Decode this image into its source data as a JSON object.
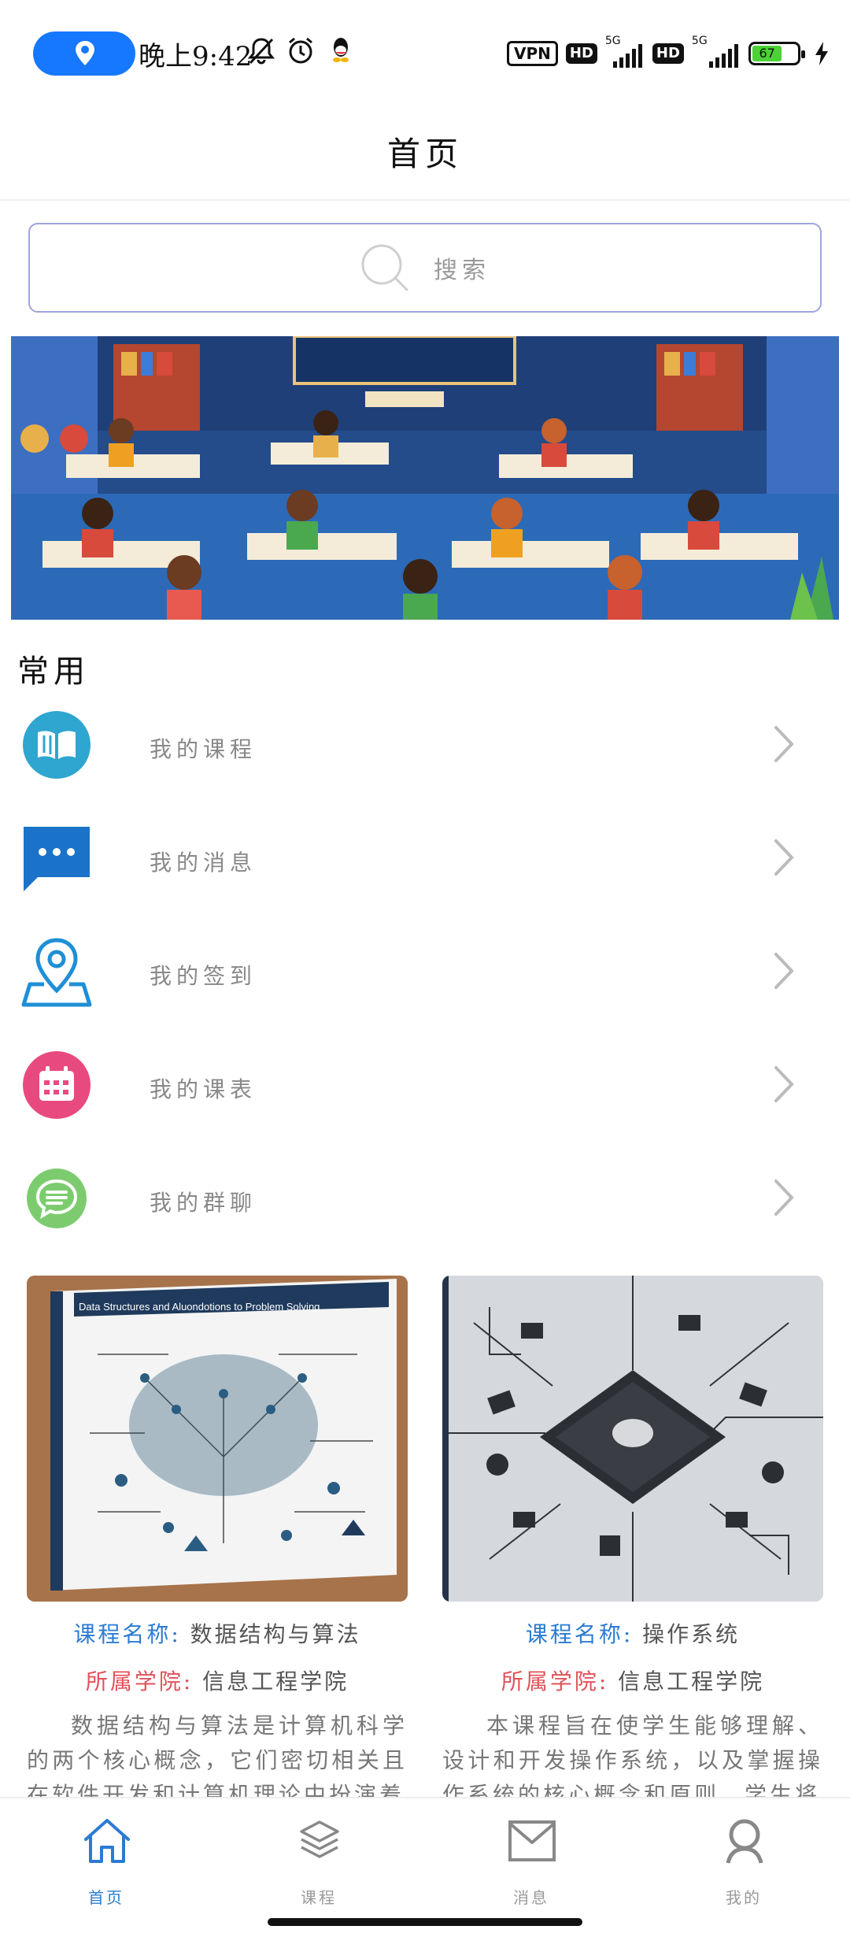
{
  "status_bar": {
    "time": "晚上9:42",
    "vpn": "VPN",
    "hd1": "HD",
    "hd2": "HD",
    "net1": "5G",
    "net2": "5G",
    "battery": "67",
    "icons": [
      "location-icon",
      "mute-icon",
      "alarm-icon",
      "qq-icon",
      "charging-icon"
    ]
  },
  "header": {
    "title": "首页"
  },
  "search": {
    "placeholder": "搜索"
  },
  "banner": {
    "icon": "classroom-illustration"
  },
  "common": {
    "title": "常用",
    "items": [
      {
        "label": "我的课程",
        "icon": "book-icon",
        "color": "#2fa6cf"
      },
      {
        "label": "我的消息",
        "icon": "message-icon",
        "color": "#1b73c9"
      },
      {
        "label": "我的签到",
        "icon": "location-pin-icon",
        "color": "#1f8fd6"
      },
      {
        "label": "我的课表",
        "icon": "calendar-icon",
        "color": "#e84a7f"
      },
      {
        "label": "我的群聊",
        "icon": "chat-icon",
        "color": "#7ccc6f"
      }
    ]
  },
  "courses": [
    {
      "name_label": "课程名称:",
      "name": "数据结构与算法",
      "college_label": "所属学院:",
      "college": "信息工程学院",
      "desc": "数据结构与算法是计算机科学的两个核心概念，它们密切相关且在软件开发和计算机理论中扮演着",
      "cover_title": "Data Structures and Aluondotions to Problem Solving"
    },
    {
      "name_label": "课程名称:",
      "name": "操作系统",
      "college_label": "所属学院:",
      "college": "信息工程学院",
      "desc": "本课程旨在使学生能够理解、设计和开发操作系统，以及掌握操作系统的核心概念和原则。学生将"
    }
  ],
  "tabbar": {
    "tabs": [
      {
        "label": "首页",
        "icon": "home-icon",
        "active": true
      },
      {
        "label": "课程",
        "icon": "layers-icon",
        "active": false
      },
      {
        "label": "消息",
        "icon": "mail-icon",
        "active": false
      },
      {
        "label": "我的",
        "icon": "user-icon",
        "active": false
      }
    ],
    "active_color": "#2b7bd3"
  }
}
